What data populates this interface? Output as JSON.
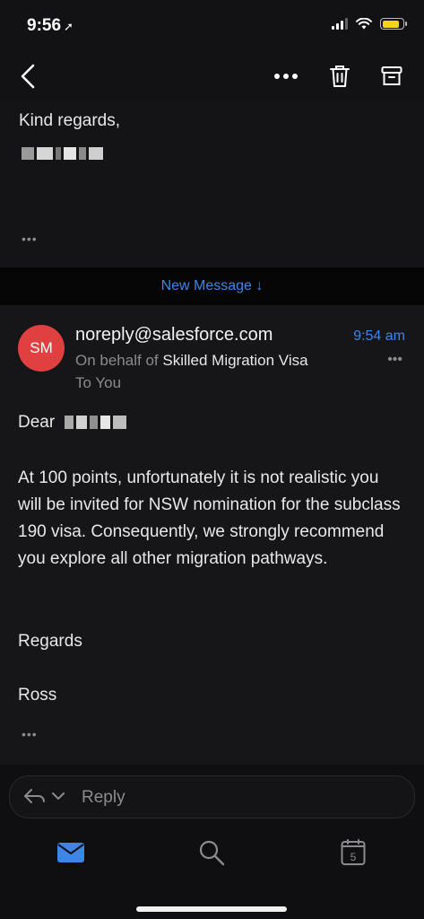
{
  "status_bar": {
    "time": "9:56",
    "location_arrow": "➚",
    "battery_level": 0.85
  },
  "nav": {
    "back_icon": "chevron-left-icon",
    "more_icon": "more-icon",
    "delete_icon": "trash-icon",
    "archive_icon": "archive-icon"
  },
  "previous_message": {
    "closing": "Kind regards,",
    "expand": "•••"
  },
  "new_message_label": "New Message ↓",
  "email": {
    "avatar_initials": "SM",
    "avatar_color": "#e04040",
    "sender": "noreply@salesforce.com",
    "time": "9:54 am",
    "behalf_prefix": "On behalf of",
    "behalf_name": "Skilled Migration Visa",
    "to": "To You",
    "more": "•••",
    "greeting": "Dear",
    "paragraph": "At 100 points, unfortunately it is not realistic you will be invited for NSW nomination for the subclass 190 visa. Consequently, we strongly recommend you explore all other migration pathways.",
    "signoff": "Regards",
    "signature": "Ross",
    "expand": "•••"
  },
  "reply": {
    "label": "Reply"
  },
  "tabbar": {
    "calendar_day": "5"
  },
  "colors": {
    "accent": "#3d86e6",
    "background": "#0d0d0f"
  }
}
